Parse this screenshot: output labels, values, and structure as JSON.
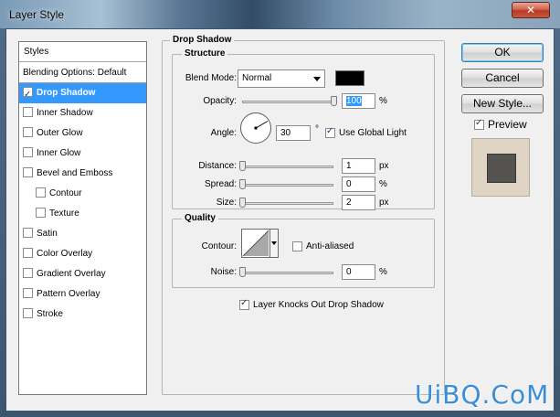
{
  "window": {
    "title": "Layer Style",
    "close_glyph": "✕"
  },
  "styles_list": {
    "header": "Styles",
    "items": [
      {
        "label": "Blending Options: Default",
        "checkbox": false,
        "checked": false,
        "selected": false,
        "indent": 0
      },
      {
        "label": "Drop Shadow",
        "checkbox": true,
        "checked": true,
        "selected": true,
        "indent": 0
      },
      {
        "label": "Inner Shadow",
        "checkbox": true,
        "checked": false,
        "selected": false,
        "indent": 0
      },
      {
        "label": "Outer Glow",
        "checkbox": true,
        "checked": false,
        "selected": false,
        "indent": 0
      },
      {
        "label": "Inner Glow",
        "checkbox": true,
        "checked": false,
        "selected": false,
        "indent": 0
      },
      {
        "label": "Bevel and Emboss",
        "checkbox": true,
        "checked": false,
        "selected": false,
        "indent": 0
      },
      {
        "label": "Contour",
        "checkbox": true,
        "checked": false,
        "selected": false,
        "indent": 1
      },
      {
        "label": "Texture",
        "checkbox": true,
        "checked": false,
        "selected": false,
        "indent": 1
      },
      {
        "label": "Satin",
        "checkbox": true,
        "checked": false,
        "selected": false,
        "indent": 0
      },
      {
        "label": "Color Overlay",
        "checkbox": true,
        "checked": false,
        "selected": false,
        "indent": 0
      },
      {
        "label": "Gradient Overlay",
        "checkbox": true,
        "checked": false,
        "selected": false,
        "indent": 0
      },
      {
        "label": "Pattern Overlay",
        "checkbox": true,
        "checked": false,
        "selected": false,
        "indent": 0
      },
      {
        "label": "Stroke",
        "checkbox": true,
        "checked": false,
        "selected": false,
        "indent": 0
      }
    ]
  },
  "drop_shadow": {
    "title": "Drop Shadow",
    "structure": {
      "title": "Structure",
      "blend_mode_label": "Blend Mode:",
      "blend_mode_value": "Normal",
      "shadow_color": "#000000",
      "opacity_label": "Opacity:",
      "opacity_value": "100",
      "opacity_unit": "%",
      "opacity_fraction": 1.0,
      "angle_label": "Angle:",
      "angle_value": "30",
      "angle_unit": "°",
      "angle_degrees": 30,
      "use_global_light_label": "Use Global Light",
      "use_global_light_checked": true,
      "distance_label": "Distance:",
      "distance_value": "1",
      "distance_unit": "px",
      "distance_fraction": 0.0,
      "spread_label": "Spread:",
      "spread_value": "0",
      "spread_unit": "%",
      "spread_fraction": 0.0,
      "size_label": "Size:",
      "size_value": "2",
      "size_unit": "px",
      "size_fraction": 0.0
    },
    "quality": {
      "title": "Quality",
      "contour_label": "Contour:",
      "anti_aliased_label": "Anti-aliased",
      "anti_aliased_checked": false,
      "noise_label": "Noise:",
      "noise_value": "0",
      "noise_unit": "%",
      "noise_fraction": 0.0
    },
    "knocks_out_label": "Layer Knocks Out Drop Shadow",
    "knocks_out_checked": true
  },
  "buttons": {
    "ok": "OK",
    "cancel": "Cancel",
    "new_style": "New Style..."
  },
  "preview": {
    "label": "Preview",
    "checked": true,
    "background_color": "#e0d5c5",
    "swatch_color": "#555350"
  },
  "watermark": {
    "text": "UiBQ.CoM"
  },
  "colors": {
    "selection": "#3399ff",
    "dialog_bg": "#f0f0f0"
  }
}
